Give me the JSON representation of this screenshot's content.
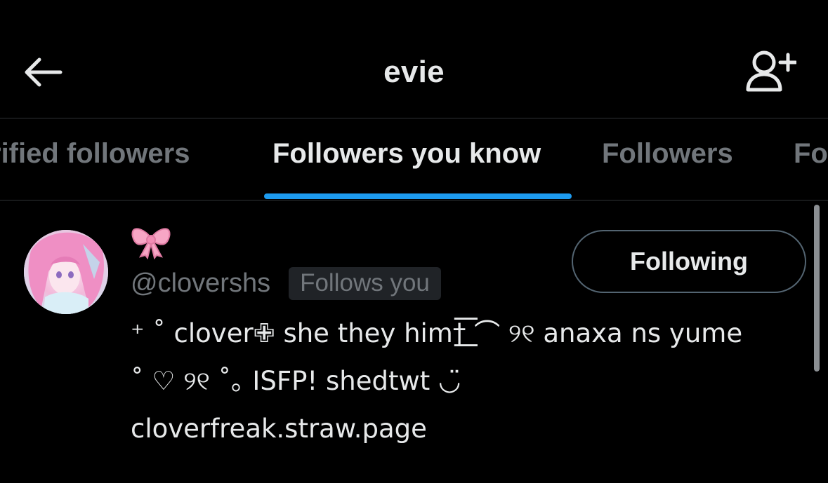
{
  "header": {
    "title": "evie",
    "back_icon": "arrow-left-icon",
    "add_icon": "add-person-icon"
  },
  "tabs": [
    {
      "label": "Verified followers",
      "visible_label": "rified followers",
      "active": false
    },
    {
      "label": "Followers you know",
      "visible_label": "Followers you know",
      "active": true
    },
    {
      "label": "Followers",
      "visible_label": "Followers",
      "active": false
    },
    {
      "label": "Following",
      "visible_label": "Fo",
      "active": false
    }
  ],
  "user": {
    "display_name": "🎀",
    "handle": "@clovershs",
    "follows_you": "Follows you",
    "button_label": "Following",
    "bio": {
      "line1": "⁺ ˚ clover✙ she they him†͟͟͞͞ ⌒ ୨୧ anaxa ns yume",
      "line2": "˚ ♡ ୨୧ ˚｡ ISFP! shedtwt ◡̈",
      "link": "cloverfreak.straw.page"
    }
  },
  "colors": {
    "background": "#000000",
    "text_primary": "#e7e9ea",
    "text_secondary": "#71767b",
    "accent": "#1d9bf0",
    "border": "#2f3336"
  }
}
